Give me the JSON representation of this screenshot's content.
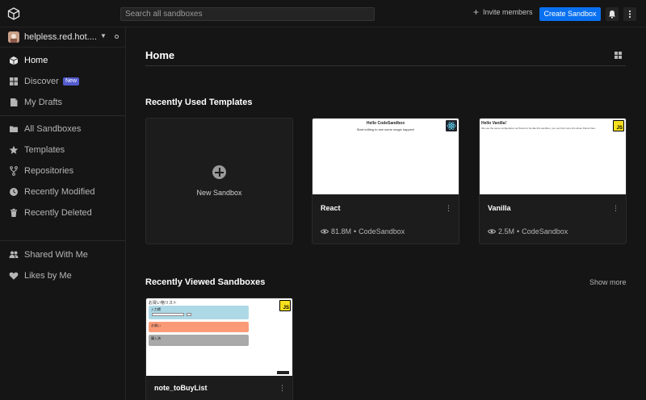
{
  "topbar": {
    "search_placeholder": "Search all sandboxes",
    "invite_label": "Invite members",
    "create_label": "Create Sandbox"
  },
  "workspace": {
    "name": "helpless.red.hot...."
  },
  "sidebar": {
    "items": [
      {
        "label": "Home",
        "icon": "home-icon"
      },
      {
        "label": "Discover",
        "icon": "discover-grid-icon",
        "badge": "New"
      },
      {
        "label": "My Drafts",
        "icon": "drafts-icon"
      },
      {
        "label": "All Sandboxes",
        "icon": "folder-icon"
      },
      {
        "label": "Templates",
        "icon": "star-icon"
      },
      {
        "label": "Repositories",
        "icon": "repo-fork-icon"
      },
      {
        "label": "Recently Modified",
        "icon": "clock-icon"
      },
      {
        "label": "Recently Deleted",
        "icon": "trash-icon"
      },
      {
        "label": "Shared With Me",
        "icon": "people-icon"
      },
      {
        "label": "Likes by Me",
        "icon": "heart-icon"
      }
    ]
  },
  "main": {
    "title": "Home",
    "recent_templates_title": "Recently Used Templates",
    "new_sandbox_label": "New Sandbox",
    "templates": [
      {
        "name": "React",
        "views": "81.8M",
        "author": "CodeSandbox",
        "thumb_title": "Hello CodeSandbox",
        "thumb_sub": "Start editing to see some magic happen!"
      },
      {
        "name": "Vanilla",
        "views": "2.5M",
        "author": "CodeSandbox",
        "thumb_title": "Hello Vanilla!",
        "thumb_sub": "We use the same configuration as Parcel to bundle this sandbox, you can find more info about Parcel here."
      }
    ],
    "recent_viewed_title": "Recently Viewed Sandboxes",
    "show_more_label": "Show more",
    "viewed": [
      {
        "name": "note_toBuyList",
        "thumb_title": "お買い物リスト",
        "rows": [
          "入力欄",
          "お買い",
          "購入済"
        ]
      }
    ]
  },
  "colors": {
    "accent": "#0971f1",
    "badge": "#535bcf",
    "js_yellow": "#f7df1e",
    "react_cyan": "#61dafb"
  }
}
